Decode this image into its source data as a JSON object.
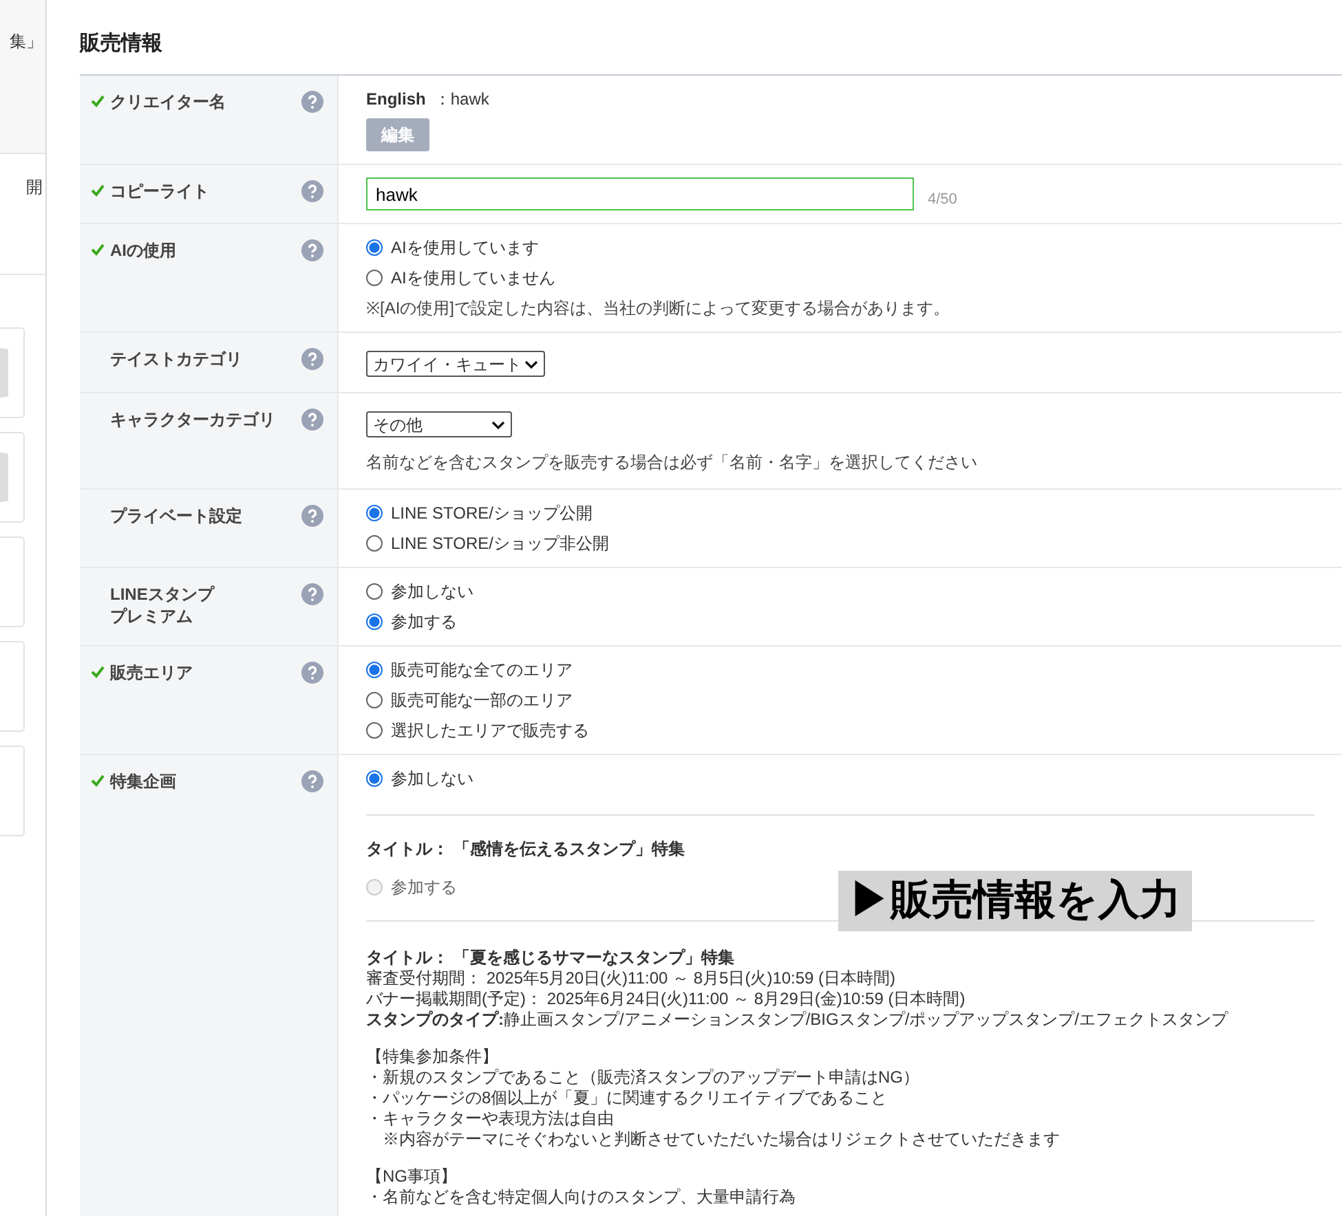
{
  "sidebar": {
    "items": [
      {
        "text": "集」"
      },
      {
        "text": "開"
      }
    ],
    "cards": [
      {
        "kind": "avatar"
      },
      {
        "kind": "avatar"
      },
      {
        "kind": "plain"
      },
      {
        "kind": "plain"
      },
      {
        "kind": "plain"
      }
    ]
  },
  "section_title": "販売情報",
  "rows": [
    {
      "label": [
        "クリエイター名"
      ],
      "done": true,
      "kind": "creator",
      "language": "English",
      "separator": "：",
      "name": "hawk",
      "button": "編集"
    },
    {
      "label": [
        "コピーライト"
      ],
      "done": true,
      "kind": "text",
      "value": "hawk",
      "counter": "4/50"
    },
    {
      "label": [
        "AIの使用"
      ],
      "done": true,
      "kind": "radio",
      "options": [
        {
          "label": "AIを使用しています",
          "selected": true
        },
        {
          "label": "AIを使用していません",
          "selected": false
        }
      ],
      "note": "※[AIの使用]で設定した内容は、当社の判断によって変更する場合があります。"
    },
    {
      "label": [
        "テイストカテゴリ"
      ],
      "done": false,
      "kind": "select",
      "value": "カワイイ・キュート"
    },
    {
      "label": [
        "キャラクターカテゴリ"
      ],
      "done": false,
      "kind": "select",
      "value": "その他",
      "note": "名前などを含むスタンプを販売する場合は必ず「名前・名字」を選択してください"
    },
    {
      "label": [
        "プライベート設定"
      ],
      "done": false,
      "kind": "radio",
      "options": [
        {
          "label": "LINE STORE/ショップ公開",
          "selected": true
        },
        {
          "label": "LINE STORE/ショップ非公開",
          "selected": false
        }
      ]
    },
    {
      "label": [
        "LINEスタンプ",
        "プレミアム"
      ],
      "done": false,
      "kind": "radio",
      "options": [
        {
          "label": "参加しない",
          "selected": false
        },
        {
          "label": "参加する",
          "selected": true
        }
      ]
    },
    {
      "label": [
        "販売エリア"
      ],
      "done": true,
      "kind": "radio",
      "options": [
        {
          "label": "販売可能な全てのエリア",
          "selected": true
        },
        {
          "label": "販売可能な一部のエリア",
          "selected": false
        },
        {
          "label": "選択したエリアで販売する",
          "selected": false
        }
      ]
    },
    {
      "label": [
        "特集企画"
      ],
      "done": true,
      "kind": "feature",
      "options": [
        {
          "label": "参加しない",
          "selected": true
        }
      ],
      "campaigns": [
        {
          "title": "タイトル： 「感情を伝えるスタンプ」特集",
          "option": {
            "label": "参加する",
            "selected": false,
            "disabled": true
          }
        },
        {
          "title": "タイトル： 「夏を感じるサマーなスタンプ」特集",
          "paragraphs": [
            [
              "審査受付期間： 2025年5月20日(火)11:00 ～ 8月5日(火)10:59 (日本時間)",
              "バナー掲載期間(予定)： 2025年6月24日(火)11:00 ～ 8月29日(金)10:59 (日本時間)",
              "**スタンプのタイプ:**静止画スタンプ/アニメーションスタンプ/BIGスタンプ/ポップアップスタンプ/エフェクトスタンプ"
            ],
            [
              "【特集参加条件】",
              "・新規のスタンプであること（販売済スタンプのアップデート申請はNG）",
              "・パッケージの8個以上が「夏」に関連するクリエイティブであること",
              "・キャラクターや表現方法は自由",
              "　※内容がテーマにそぐわないと判断させていただいた場合はリジェクトさせていただきます"
            ],
            [
              "【NG事項】",
              "・名前などを含む特定個人向けのスタンプ、大量申請行為"
            ]
          ]
        }
      ]
    }
  ],
  "overlay": "▶販売情報を入力"
}
